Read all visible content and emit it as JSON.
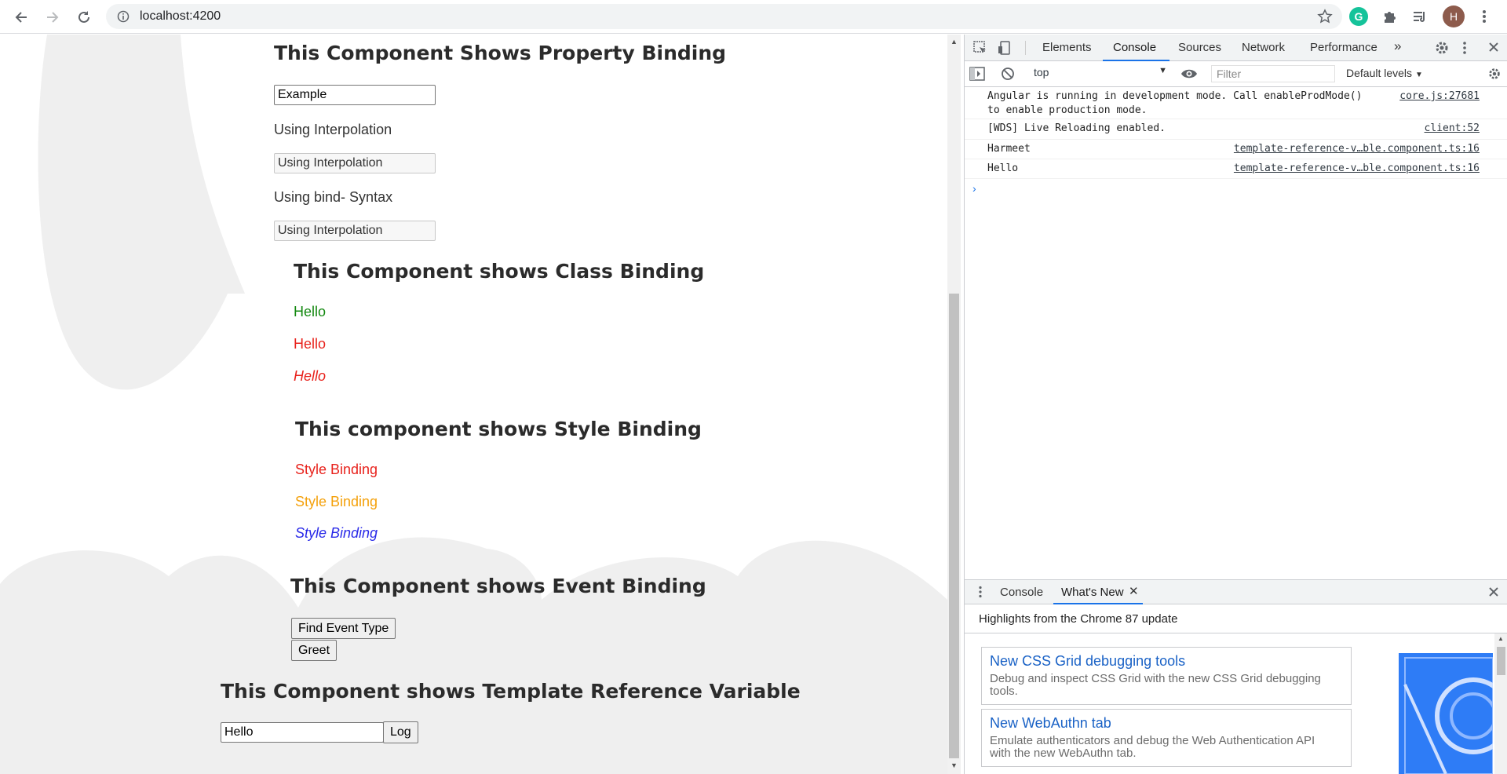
{
  "browser": {
    "url": "localhost:4200",
    "avatar_letter": "H",
    "grammarly_letter": "G"
  },
  "page": {
    "property": {
      "heading": "This Component Shows Property Binding",
      "input_value": "Example",
      "interp_label": "Using Interpolation",
      "interp_input_value": "Using Interpolation",
      "bind_label": "Using bind- Syntax",
      "bind_input_value": "Using Interpolation"
    },
    "class_binding": {
      "heading": "This Component shows Class Binding",
      "lines": [
        "Hello",
        "Hello",
        "Hello"
      ]
    },
    "style_binding": {
      "heading": "This component shows Style Binding",
      "lines": [
        "Style Binding",
        "Style Binding",
        "Style Binding"
      ]
    },
    "event_binding": {
      "heading": "This Component shows Event Binding",
      "find_button": "Find Event Type",
      "greet_button": "Greet"
    },
    "template_ref": {
      "heading": "This Component shows Template Reference Variable",
      "input_value": "Hello",
      "log_button": "Log"
    }
  },
  "colors": {
    "green": "#12880f",
    "red": "#e8221c",
    "orange": "#f4a10c",
    "blue": "#2a2ae8",
    "devtools_accent": "#1a73e8"
  },
  "devtools": {
    "tabs": [
      "Elements",
      "Console",
      "Sources",
      "Network",
      "Performance"
    ],
    "active_tab": "Console",
    "context": "top",
    "filter_placeholder": "Filter",
    "levels": "Default levels",
    "logs": [
      {
        "message": "Angular is running in development mode. Call enableProdMode()\nto enable production mode.",
        "source": "core.js:27681"
      },
      {
        "message": "[WDS] Live Reloading enabled.",
        "source": "client:52"
      },
      {
        "message": "Harmeet",
        "source": "template-reference-v…ble.component.ts:16"
      },
      {
        "message": "Hello",
        "source": "template-reference-v…ble.component.ts:16"
      }
    ],
    "drawer": {
      "tabs": [
        "Console",
        "What's New"
      ],
      "title": "Highlights from the Chrome 87 update",
      "cards": [
        {
          "title": "New CSS Grid debugging tools",
          "desc": "Debug and inspect CSS Grid with the new CSS Grid debugging tools."
        },
        {
          "title": "New WebAuthn tab",
          "desc": "Emulate authenticators and debug the Web Authentication API with the new WebAuthn tab."
        }
      ]
    }
  }
}
